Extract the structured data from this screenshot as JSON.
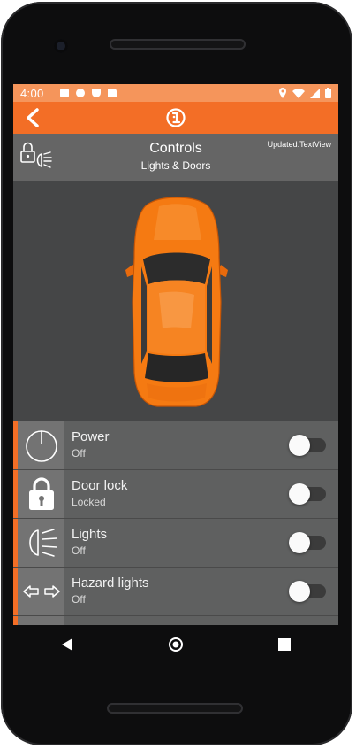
{
  "status_bar": {
    "time": "4:00",
    "left_icons": [
      "a-icon",
      "gear-icon",
      "shield-icon",
      "sd-card-icon"
    ],
    "right_icons": [
      "location-icon",
      "wifi-icon",
      "signal-icon",
      "battery-icon"
    ],
    "background": "#f5955b"
  },
  "app_bar": {
    "back_icon": "chevron-left-icon",
    "logo_icon": "brand-logo-icon",
    "background": "#f36e26"
  },
  "header": {
    "icon": "lock-lights-icon",
    "title": "Controls",
    "subtitle": "Lights & Doors",
    "updated": "Updated:TextView"
  },
  "car": {
    "image": "car-top-view",
    "color": "#f57a12"
  },
  "controls": [
    {
      "icon": "power-icon",
      "label": "Power",
      "status": "Off",
      "enabled": false
    },
    {
      "icon": "padlock-icon",
      "label": "Door lock",
      "status": "Locked",
      "enabled": false
    },
    {
      "icon": "headlight-icon",
      "label": "Lights",
      "status": "Off",
      "enabled": false
    },
    {
      "icon": "hazard-arrows-icon",
      "label": "Hazard lights",
      "status": "Off",
      "enabled": false
    }
  ],
  "nav_bar": {
    "buttons": [
      "back-triangle-icon",
      "home-circle-icon",
      "recents-square-icon"
    ]
  }
}
